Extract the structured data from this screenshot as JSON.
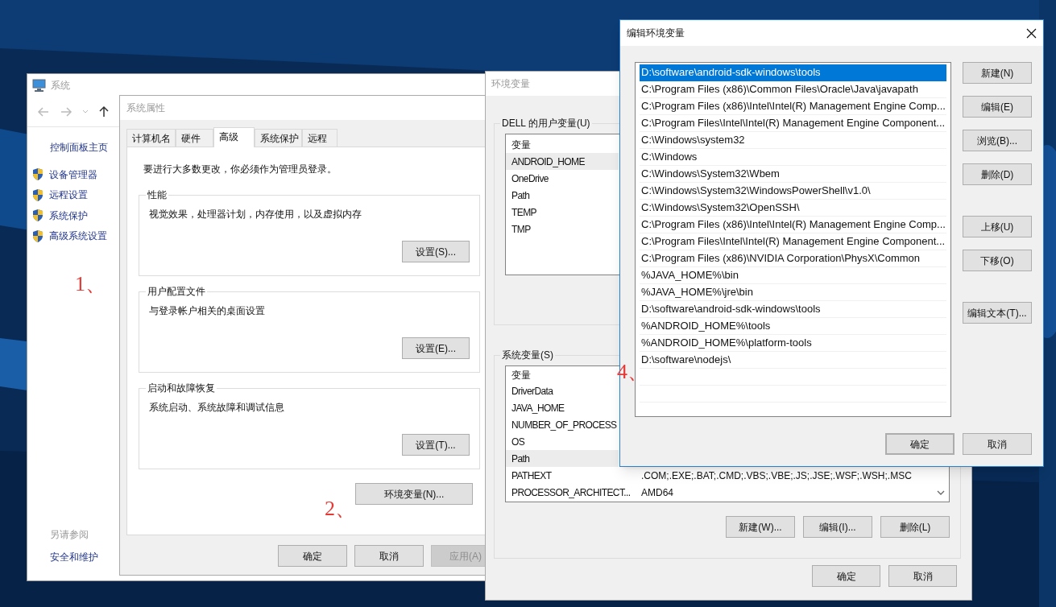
{
  "system_window": {
    "title": "系统",
    "sidebar": {
      "home": "控制面板主页",
      "items": [
        {
          "label": "设备管理器"
        },
        {
          "label": "远程设置"
        },
        {
          "label": "系统保护"
        },
        {
          "label": "高级系统设置"
        }
      ],
      "see_also_heading": "另请参阅",
      "see_also": [
        "安全和维护"
      ]
    }
  },
  "system_properties": {
    "title": "系统属性",
    "tabs": [
      {
        "label": "计算机名",
        "selected": false
      },
      {
        "label": "硬件",
        "selected": false
      },
      {
        "label": "高级",
        "selected": true
      },
      {
        "label": "系统保护",
        "selected": false
      },
      {
        "label": "远程",
        "selected": false
      }
    ],
    "admin_note": "要进行大多数更改，你必须作为管理员登录。",
    "groups": [
      {
        "title": "性能",
        "description": "视觉效果，处理器计划，内存使用，以及虚拟内存",
        "button": "设置(S)..."
      },
      {
        "title": "用户配置文件",
        "description": "与登录帐户相关的桌面设置",
        "button": "设置(E)..."
      },
      {
        "title": "启动和故障恢复",
        "description": "系统启动、系统故障和调试信息",
        "button": "设置(T)..."
      }
    ],
    "env_button": "环境变量(N)...",
    "buttons": [
      {
        "label": "确定",
        "disabled": false
      },
      {
        "label": "取消",
        "disabled": false
      },
      {
        "label": "应用(A)",
        "disabled": true
      }
    ]
  },
  "environment_variables": {
    "title": "环境变量",
    "user_group": {
      "title": "DELL 的用户变量(U)",
      "column": "变量",
      "rows": [
        {
          "name": "ANDROID_HOME",
          "selected": true
        },
        {
          "name": "OneDrive",
          "selected": false
        },
        {
          "name": "Path",
          "selected": false
        },
        {
          "name": "TEMP",
          "selected": false
        },
        {
          "name": "TMP",
          "selected": false
        }
      ]
    },
    "system_group": {
      "title": "系统变量(S)",
      "column": "变量",
      "rows": [
        {
          "name": "DriverData",
          "selected": false
        },
        {
          "name": "JAVA_HOME",
          "selected": false
        },
        {
          "name": "NUMBER_OF_PROCESS",
          "selected": false
        },
        {
          "name": "OS",
          "selected": false
        },
        {
          "name": "Path",
          "selected": true
        },
        {
          "name": "PATHEXT",
          "value": ".COM;.EXE;.BAT;.CMD;.VBS;.VBE;.JS;.JSE;.WSF;.WSH;.MSC",
          "selected": false
        },
        {
          "name": "PROCESSOR_ARCHITECT...",
          "value": "AMD64",
          "selected": false
        }
      ],
      "buttons": [
        "新建(W)...",
        "编辑(I)...",
        "删除(L)"
      ]
    },
    "buttons": [
      "确定",
      "取消"
    ]
  },
  "edit_dialog": {
    "title": "编辑环境变量",
    "entries": [
      {
        "text": "D:\\software\\android-sdk-windows\\tools",
        "selected": true
      },
      {
        "text": "C:\\Program Files (x86)\\Common Files\\Oracle\\Java\\javapath",
        "selected": false
      },
      {
        "text": "C:\\Program Files (x86)\\Intel\\Intel(R) Management Engine Comp...",
        "selected": false
      },
      {
        "text": "C:\\Program Files\\Intel\\Intel(R) Management Engine Component...",
        "selected": false
      },
      {
        "text": "C:\\Windows\\system32",
        "selected": false
      },
      {
        "text": "C:\\Windows",
        "selected": false
      },
      {
        "text": "C:\\Windows\\System32\\Wbem",
        "selected": false
      },
      {
        "text": "C:\\Windows\\System32\\WindowsPowerShell\\v1.0\\",
        "selected": false
      },
      {
        "text": "C:\\Windows\\System32\\OpenSSH\\",
        "selected": false
      },
      {
        "text": "C:\\Program Files (x86)\\Intel\\Intel(R) Management Engine Comp...",
        "selected": false
      },
      {
        "text": "C:\\Program Files\\Intel\\Intel(R) Management Engine Component...",
        "selected": false
      },
      {
        "text": "C:\\Program Files (x86)\\NVIDIA Corporation\\PhysX\\Common",
        "selected": false
      },
      {
        "text": "%JAVA_HOME%\\bin",
        "selected": false
      },
      {
        "text": "%JAVA_HOME%\\jre\\bin",
        "selected": false
      },
      {
        "text": "D:\\software\\android-sdk-windows\\tools",
        "selected": false
      },
      {
        "text": "%ANDROID_HOME%\\tools",
        "selected": false
      },
      {
        "text": "%ANDROID_HOME%\\platform-tools",
        "selected": false
      },
      {
        "text": "D:\\software\\nodejs\\",
        "selected": false
      }
    ],
    "side_buttons": [
      [
        "新建(N)",
        "编辑(E)",
        "浏览(B)...",
        "删除(D)"
      ],
      [
        "上移(U)",
        "下移(O)"
      ],
      [
        "编辑文本(T)..."
      ]
    ],
    "buttons": [
      {
        "label": "确定",
        "default": true
      },
      {
        "label": "取消",
        "default": false
      }
    ]
  },
  "annotations": [
    {
      "text": "1、"
    },
    {
      "text": "2、"
    },
    {
      "text": "4、"
    }
  ]
}
